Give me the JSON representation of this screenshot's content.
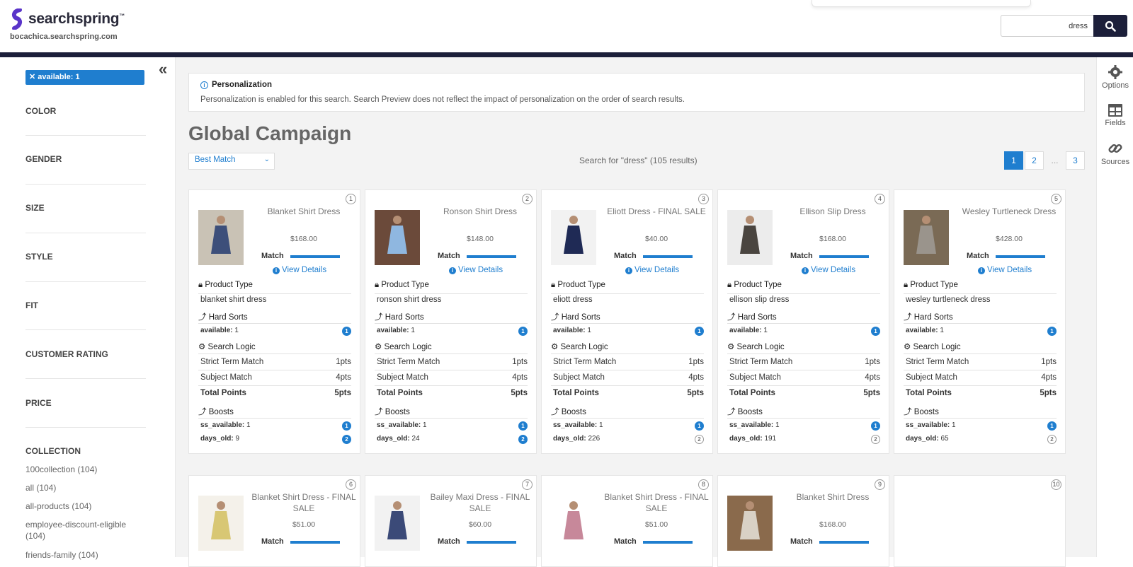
{
  "header": {
    "brand": "searchspring",
    "brand_tm": "™",
    "site": "bocachica.searchspring.com",
    "search_value": "dress"
  },
  "sidebar": {
    "active_filter": "available: 1",
    "facets": [
      "COLOR",
      "GENDER",
      "SIZE",
      "STYLE",
      "FIT",
      "CUSTOMER RATING",
      "PRICE",
      "COLLECTION"
    ],
    "collection_options": [
      "100collection (104)",
      "all (104)",
      "all-products (104)",
      "employee-discount-eligible (104)",
      "friends-family (104)"
    ]
  },
  "notice": {
    "title": "Personalization",
    "text": "Personalization is enabled for this search. Search Preview does not reflect the impact of personalization on the order of search results."
  },
  "campaign_title": "Global Campaign",
  "sort": {
    "selected": "Best Match"
  },
  "results_summary": "Search for \"dress\" (105 results)",
  "pagination": [
    "1",
    "2",
    "...",
    "3"
  ],
  "labels": {
    "match": "Match",
    "view_details": "View Details",
    "product_type": "Product Type",
    "hard_sorts": "Hard Sorts",
    "search_logic": "Search Logic",
    "boosts": "Boosts",
    "available_key": "available:",
    "ss_available_key": "ss_available:",
    "days_old_key": "days_old:",
    "strict_term": "Strict Term Match",
    "subject_match": "Subject Match",
    "total_points": "Total Points"
  },
  "products": [
    {
      "rank": "1",
      "name": "Blanket Shirt Dress",
      "price": "$168.00",
      "type": "blanket shirt dress",
      "available": "1",
      "available_badge": "1",
      "strict": "1pts",
      "subject": "4pts",
      "total": "5pts",
      "ss_available": "1",
      "ss_badge": "1",
      "days_old": "9",
      "days_badge": "2",
      "days_badge_style": "filled",
      "thumb_colors": [
        "#c9c2b5",
        "#3d4f7a"
      ]
    },
    {
      "rank": "2",
      "name": "Ronson Shirt Dress",
      "price": "$148.00",
      "type": "ronson shirt dress",
      "available": "1",
      "available_badge": "1",
      "strict": "1pts",
      "subject": "4pts",
      "total": "5pts",
      "ss_available": "1",
      "ss_badge": "1",
      "days_old": "24",
      "days_badge": "2",
      "days_badge_style": "filled",
      "thumb_colors": [
        "#6b4a3a",
        "#8fb7e0"
      ]
    },
    {
      "rank": "3",
      "name": "Eliott Dress - FINAL SALE",
      "price": "$40.00",
      "type": "eliott dress",
      "available": "1",
      "available_badge": "1",
      "strict": "1pts",
      "subject": "4pts",
      "total": "5pts",
      "ss_available": "1",
      "ss_badge": "1",
      "days_old": "226",
      "days_badge": "2",
      "days_badge_style": "outline",
      "thumb_colors": [
        "#f2f2f2",
        "#1f2a55"
      ]
    },
    {
      "rank": "4",
      "name": "Ellison Slip Dress",
      "price": "$168.00",
      "type": "ellison slip dress",
      "available": "1",
      "available_badge": "1",
      "strict": "1pts",
      "subject": "4pts",
      "total": "5pts",
      "ss_available": "1",
      "ss_badge": "1",
      "days_old": "191",
      "days_badge": "2",
      "days_badge_style": "outline",
      "thumb_colors": [
        "#ececec",
        "#4a4540"
      ]
    },
    {
      "rank": "5",
      "name": "Wesley Turtleneck Dress",
      "price": "$428.00",
      "type": "wesley turtleneck dress",
      "available": "1",
      "available_badge": "1",
      "strict": "1pts",
      "subject": "4pts",
      "total": "5pts",
      "ss_available": "1",
      "ss_badge": "1",
      "days_old": "65",
      "days_badge": "2",
      "days_badge_style": "outline",
      "thumb_colors": [
        "#7a6a55",
        "#9a948c"
      ]
    }
  ],
  "products_row2": [
    {
      "rank": "6",
      "name": "Blanket Shirt Dress - FINAL SALE",
      "price": "$51.00",
      "thumb_colors": [
        "#f4f1ea",
        "#d8c774"
      ]
    },
    {
      "rank": "7",
      "name": "Bailey Maxi Dress - FINAL SALE",
      "price": "$60.00",
      "thumb_colors": [
        "#f2f2f2",
        "#3b4a78"
      ]
    },
    {
      "rank": "8",
      "name": "Blanket Shirt Dress - FINAL SALE",
      "price": "$51.00",
      "thumb_colors": [
        "#ffffff",
        "#c7889a"
      ]
    },
    {
      "rank": "9",
      "name": "Blanket Shirt Dress",
      "price": "$168.00",
      "thumb_colors": [
        "#8a6a4c",
        "#d9d1c5"
      ]
    },
    {
      "rank": "10"
    }
  ],
  "rail": [
    "Options",
    "Fields",
    "Sources"
  ],
  "colors": {
    "accent": "#1f7ecf",
    "navy": "#1c1f3a",
    "brand_purple": "#5a34c9"
  },
  "icons": [
    "search-icon",
    "collapse-icon",
    "info-icon",
    "lock-icon",
    "sort-arrow-icon",
    "gear-icon",
    "table-icon",
    "link-icon",
    "close-icon"
  ]
}
